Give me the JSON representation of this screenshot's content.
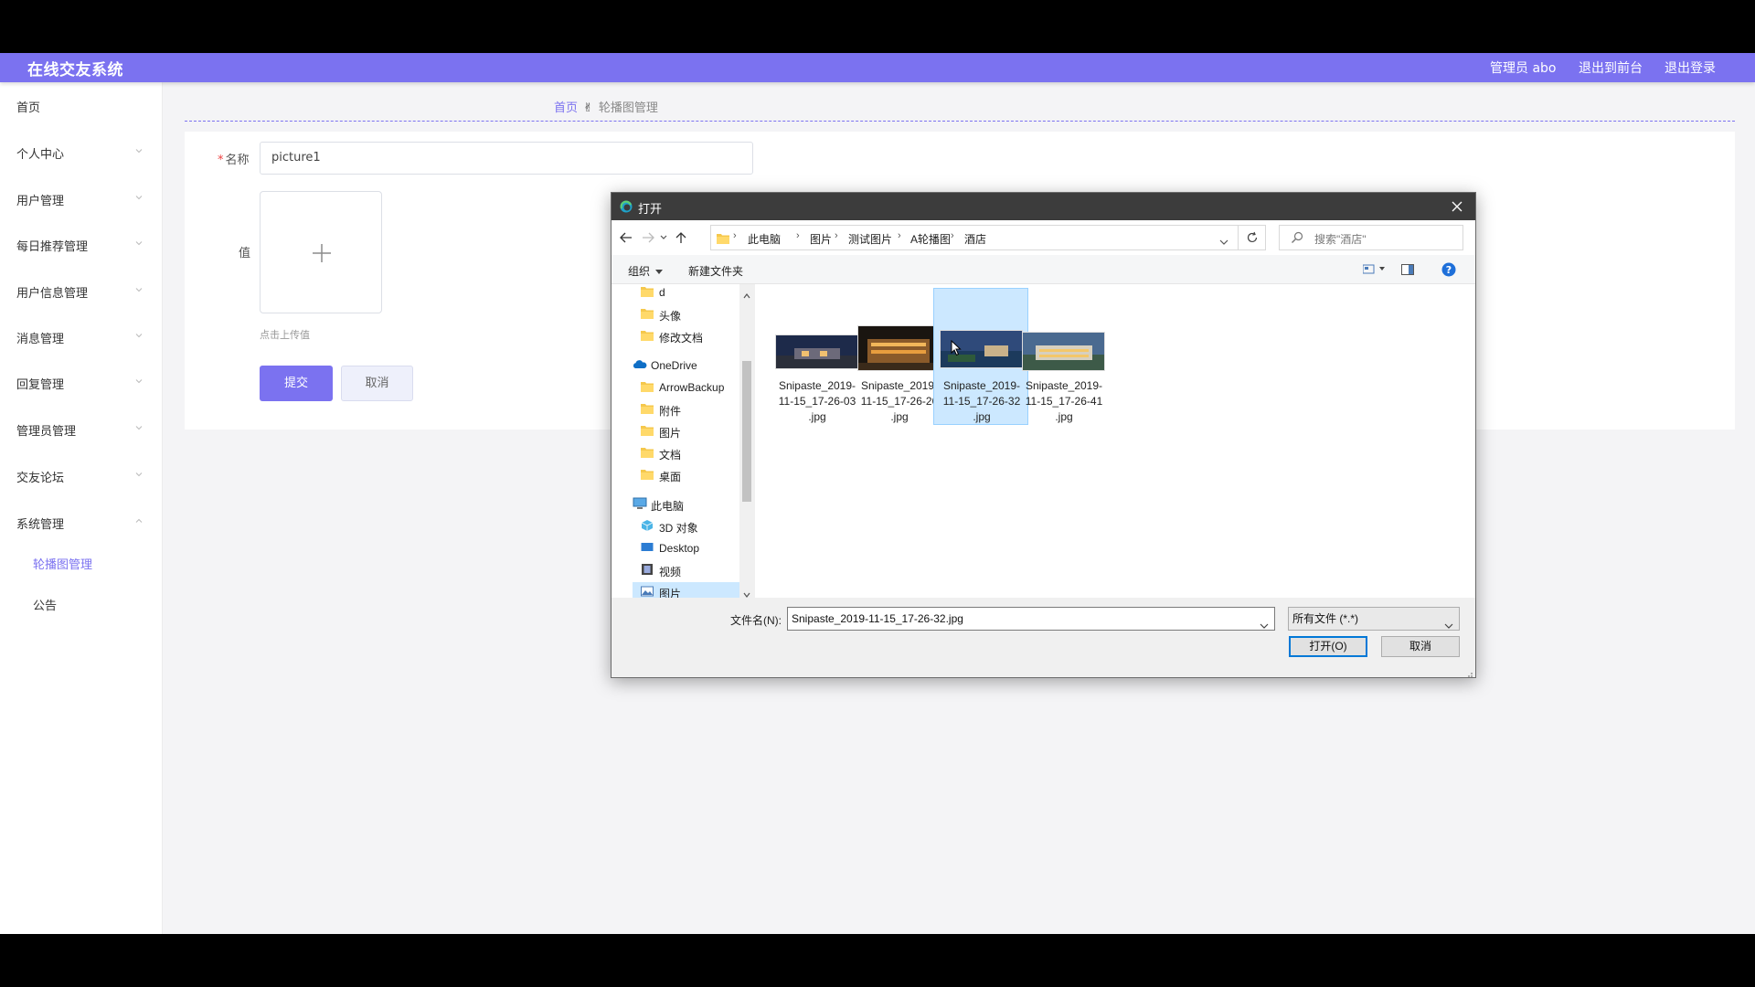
{
  "app": {
    "title": "在线交友系统",
    "top_links": [
      "管理员 abo",
      "退出到前台",
      "退出登录"
    ]
  },
  "sidebar": {
    "items": [
      {
        "label": "首页",
        "has_chevron": false
      },
      {
        "label": "个人中心",
        "has_chevron": true
      },
      {
        "label": "用户管理",
        "has_chevron": true
      },
      {
        "label": "每日推荐管理",
        "has_chevron": true
      },
      {
        "label": "用户信息管理",
        "has_chevron": true
      },
      {
        "label": "消息管理",
        "has_chevron": true
      },
      {
        "label": "回复管理",
        "has_chevron": true
      },
      {
        "label": "管理员管理",
        "has_chevron": true
      },
      {
        "label": "交友论坛",
        "has_chevron": true
      },
      {
        "label": "系统管理",
        "has_chevron": true,
        "expanded": true
      }
    ],
    "subitems": [
      {
        "label": "轮播图管理",
        "active": true
      },
      {
        "label": "公告",
        "active": false
      }
    ]
  },
  "breadcrumb": {
    "home": "首页",
    "current": "轮播图管理"
  },
  "form": {
    "name_label": "名称",
    "name_value": "picture1",
    "value_label": "值",
    "upload_hint": "点击上传值",
    "submit_label": "提交",
    "cancel_label": "取消"
  },
  "dialog": {
    "title": "打开",
    "path": [
      "此电脑",
      "图片",
      "测试图片",
      "A轮播图",
      "酒店"
    ],
    "search_placeholder": "搜索\"酒店\"",
    "toolbar": {
      "organize": "组织",
      "new_folder": "新建文件夹"
    },
    "nav_tree": [
      {
        "label": "d",
        "icon": "folder-icon"
      },
      {
        "label": "头像",
        "icon": "folder-icon"
      },
      {
        "label": "修改文档",
        "icon": "folder-icon"
      },
      {
        "label": "OneDrive",
        "icon": "cloud-icon"
      },
      {
        "label": "ArrowBackup",
        "icon": "folder-icon"
      },
      {
        "label": "附件",
        "icon": "folder-icon"
      },
      {
        "label": "图片",
        "icon": "folder-icon"
      },
      {
        "label": "文档",
        "icon": "folder-icon"
      },
      {
        "label": "桌面",
        "icon": "folder-icon"
      },
      {
        "label": "此电脑",
        "icon": "computer-icon"
      },
      {
        "label": "3D 对象",
        "icon": "cube-icon"
      },
      {
        "label": "Desktop",
        "icon": "desktop-icon"
      },
      {
        "label": "视频",
        "icon": "video-icon"
      },
      {
        "label": "图片",
        "icon": "pictures-icon",
        "selected": true
      }
    ],
    "files": [
      {
        "line1": "Snipaste_2019-",
        "line2": "11-15_17-26-03",
        "line3": ".jpg",
        "selected": false
      },
      {
        "line1": "Snipaste_2019-",
        "line2": "11-15_17-26-20",
        "line3": ".jpg",
        "selected": false
      },
      {
        "line1": "Snipaste_2019-",
        "line2": "11-15_17-26-32",
        "line3": ".jpg",
        "selected": true
      },
      {
        "line1": "Snipaste_2019-",
        "line2": "11-15_17-26-41",
        "line3": ".jpg",
        "selected": false
      }
    ],
    "filename_label": "文件名(N):",
    "filename_value": "Snipaste_2019-11-15_17-26-32.jpg",
    "filetype_value": "所有文件 (*.*)",
    "open_label": "打开(O)",
    "cancel_label": "取消"
  },
  "colors": {
    "accent": "#7b72f0",
    "dialog_titlebar": "#3c3c3c",
    "selection": "#cce8ff"
  }
}
